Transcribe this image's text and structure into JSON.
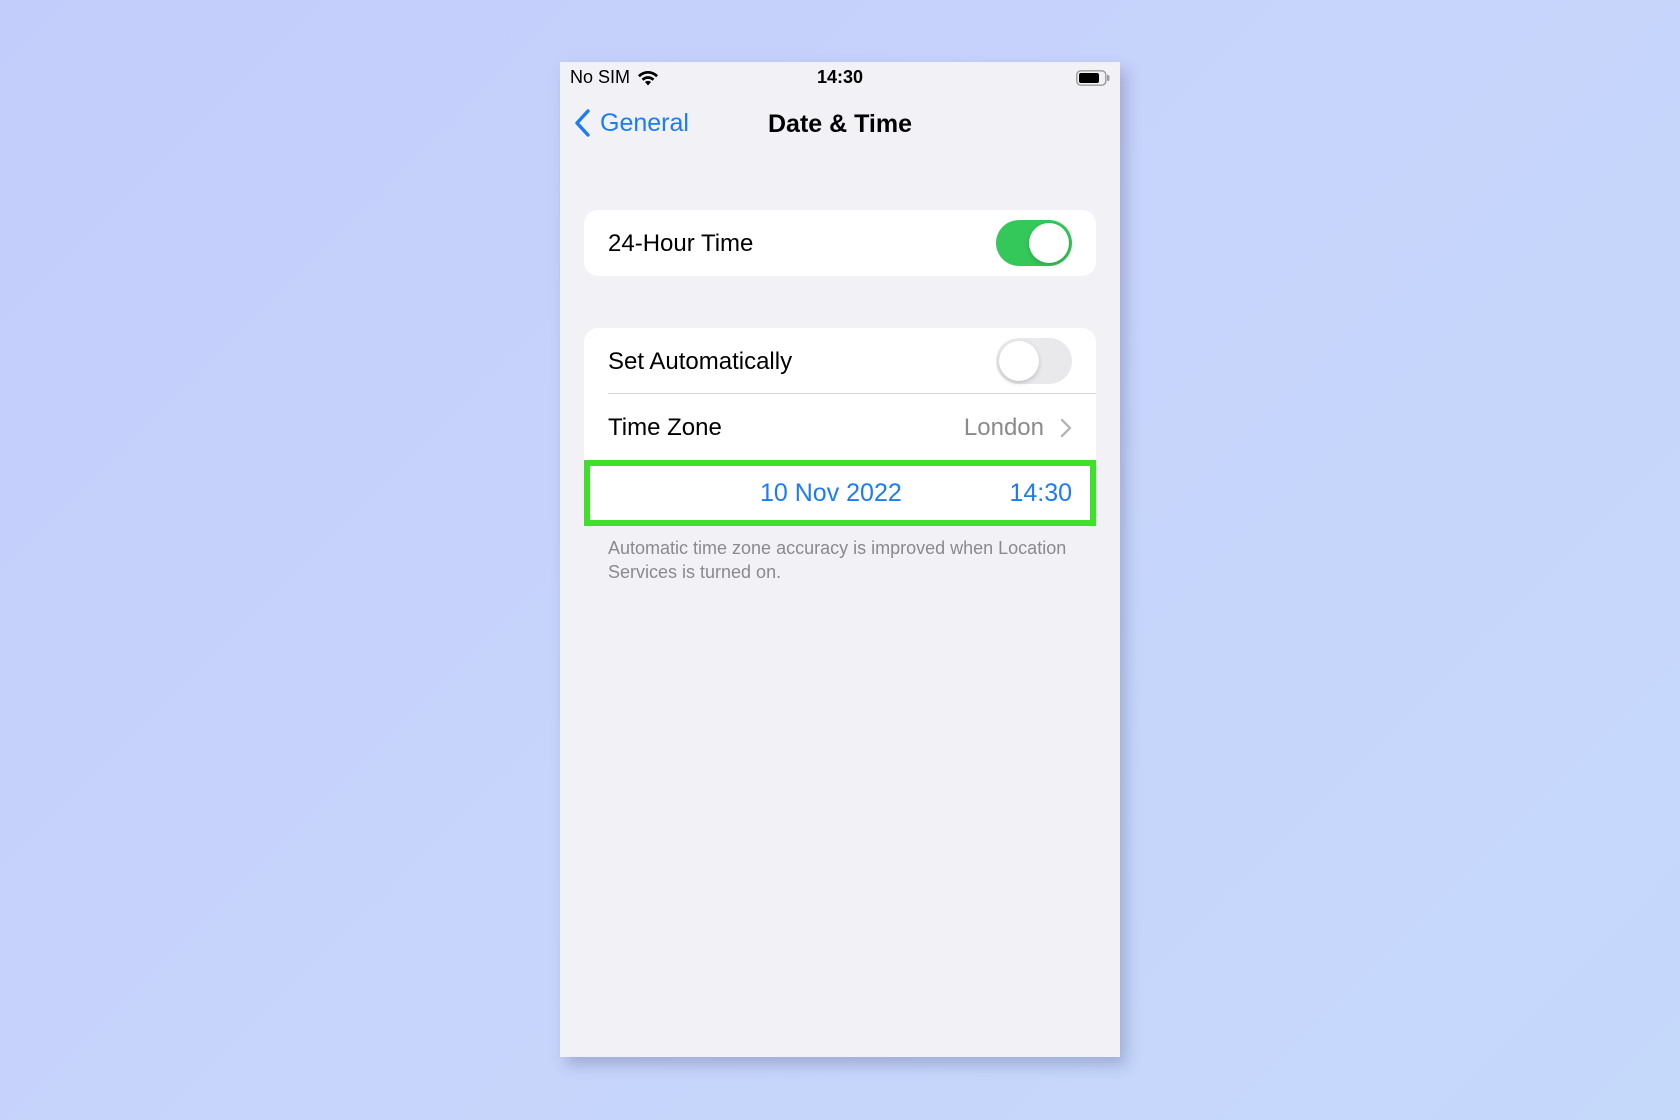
{
  "status_bar": {
    "carrier": "No SIM",
    "time": "14:30",
    "wifi_icon": "wifi-icon",
    "battery_icon": "battery-icon"
  },
  "nav": {
    "back_label": "General",
    "title": "Date & Time"
  },
  "settings": {
    "hour24": {
      "label": "24-Hour Time",
      "enabled": true
    },
    "set_automatically": {
      "label": "Set Automatically",
      "enabled": false
    },
    "time_zone": {
      "label": "Time Zone",
      "value": "London"
    },
    "date": "10 Nov 2022",
    "time": "14:30"
  },
  "footer_note": "Automatic time zone accuracy is improved when Location Services is turned on.",
  "colors": {
    "accent": "#1d7cf2",
    "toggle_on": "#34c759",
    "highlight": "#3ee02b",
    "background": "#f1f1f6"
  }
}
